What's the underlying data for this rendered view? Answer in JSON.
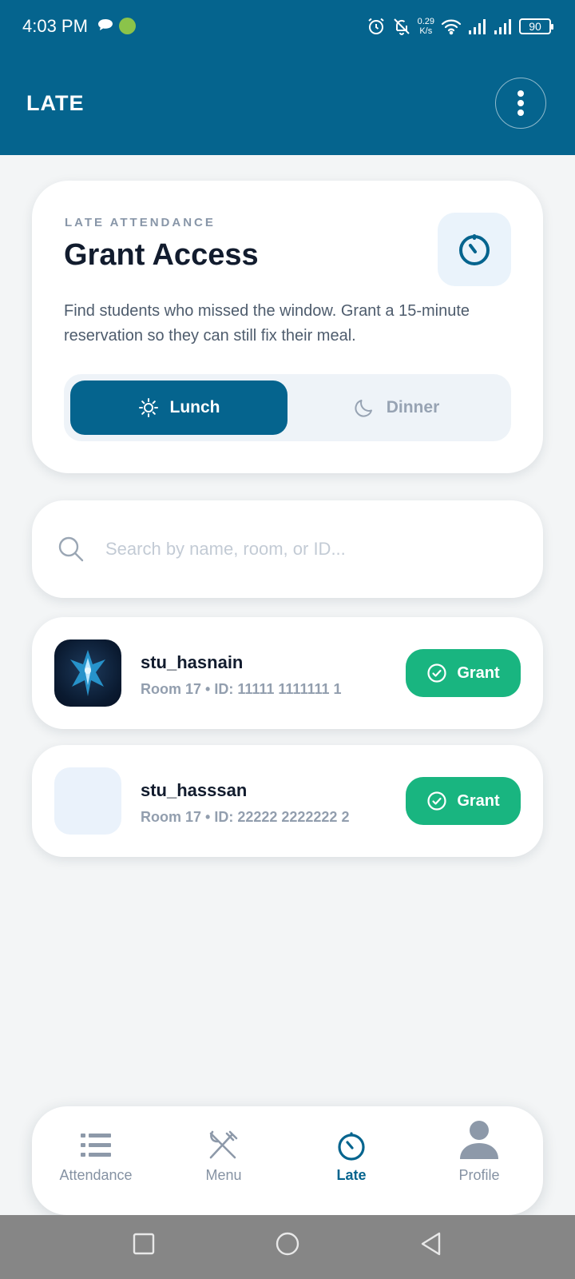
{
  "status_bar": {
    "time": "4:03 PM",
    "net_speed": "0.29",
    "net_unit": "K/s",
    "battery": "90"
  },
  "app_bar": {
    "title": "LATE"
  },
  "hero": {
    "eyebrow": "LATE ATTENDANCE",
    "title": "Grant Access",
    "description": "Find students who missed the window. Grant a 15-minute reservation so they can still fix their meal.",
    "tabs": [
      {
        "label": "Lunch",
        "icon": "sun-icon",
        "active": true
      },
      {
        "label": "Dinner",
        "icon": "moon-icon",
        "active": false
      }
    ]
  },
  "search": {
    "placeholder": "Search by name, room, or ID..."
  },
  "students": [
    {
      "name": "stu_hasnain",
      "meta": "Room 17 • ID: 11111 1111111 1",
      "action": "Grant"
    },
    {
      "name": "stu_hasssan",
      "meta": "Room 17 • ID: 22222 2222222 2",
      "action": "Grant"
    }
  ],
  "bottom_nav": [
    {
      "label": "Attendance",
      "icon": "list-icon",
      "active": false
    },
    {
      "label": "Menu",
      "icon": "utensils-icon",
      "active": false
    },
    {
      "label": "Late",
      "icon": "timer-icon",
      "active": true
    },
    {
      "label": "Profile",
      "icon": "person-icon",
      "active": false
    }
  ],
  "colors": {
    "primary": "#05648e",
    "success": "#19b580",
    "background": "#f3f5f6"
  }
}
